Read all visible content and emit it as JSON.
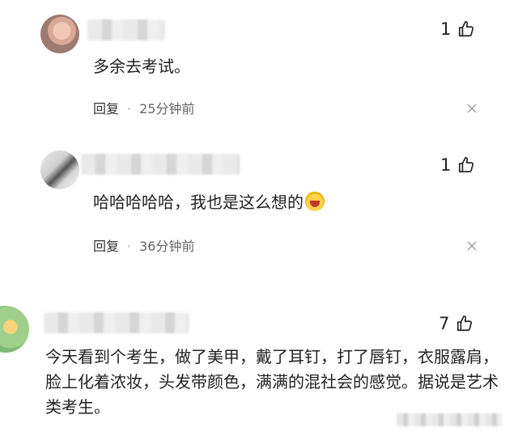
{
  "comments": [
    {
      "text": "多余去考试。",
      "likes": "1",
      "reply_label": "回复",
      "separator": "·",
      "time": "25分钟前"
    },
    {
      "text": "哈哈哈哈哈，我也是这么想的",
      "likes": "1",
      "reply_label": "回复",
      "separator": "·",
      "time": "36分钟前"
    },
    {
      "text": "今天看到个考生，做了美甲，戴了耳钉，打了唇钉，衣服露肩，脸上化着浓妆，头发带颜色，满满的混社会的感觉。据说是艺术类考生。",
      "likes": "7"
    }
  ],
  "icons": {
    "like": "thumbs-up-icon",
    "close": "close-icon",
    "emoji": "laughing-crying-emoji-icon"
  }
}
